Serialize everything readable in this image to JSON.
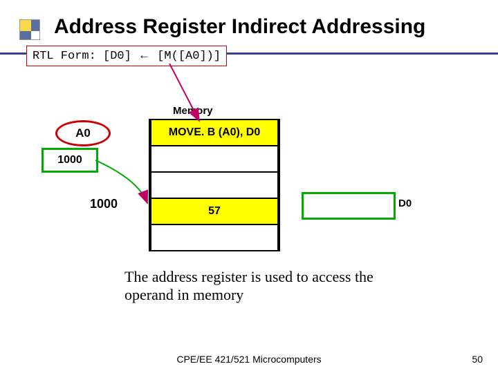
{
  "title": "Address Register Indirect Addressing",
  "rtl": {
    "lhs": "RTL Form: [D0]",
    "arrow": "←",
    "rhs": "[M([A0])]"
  },
  "memory": {
    "label": "Memory",
    "cells": [
      "MOVE. B (A0), D0",
      "",
      "",
      "57",
      ""
    ]
  },
  "reg_a0": {
    "name": "A0",
    "value": "1000"
  },
  "mem_addr": "1000",
  "dest_reg": "D0",
  "explain": "The address register is used to access the operand in memory",
  "footer": "CPE/EE 421/521 Microcomputers",
  "page": "50",
  "chart_data": {
    "type": "table",
    "title": "Memory",
    "categories": [
      "",
      "",
      "",
      "1000",
      ""
    ],
    "values": [
      "MOVE. B (A0), D0",
      "",
      "",
      "57",
      ""
    ],
    "registers": {
      "A0": "1000",
      "D0": ""
    }
  }
}
